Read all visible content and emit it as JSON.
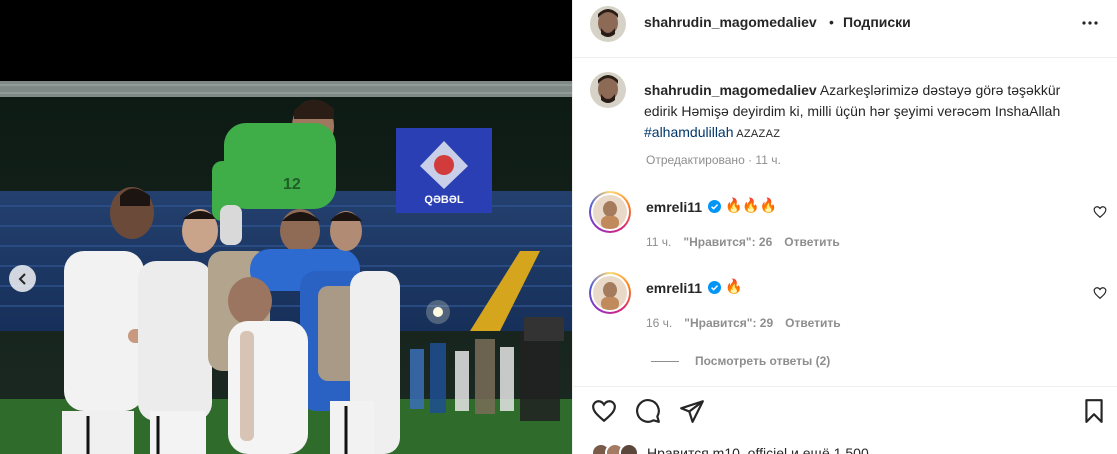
{
  "header": {
    "username": "shahrudin_magomedaliev",
    "separator": "•",
    "follow_label": "Подписки",
    "more_icon": "more-horizontal-icon"
  },
  "caption": {
    "username": "shahrudin_magomedaliev",
    "text_1": " Azarkeşlərimizə dəstəyə görə təşəkkür edirik Həmişə deyirdim ki, milli üçün hər şeyimi verəcəm InshaAllah ",
    "hashtag": "#alhamdulillah",
    "text_2": " AZAZAZ",
    "edited": "Отредактировано",
    "edited_dot": " · ",
    "edited_time": "11 ч."
  },
  "comments": [
    {
      "username": "emreli11",
      "text": "🔥🔥🔥",
      "time": "11 ч.",
      "likes": "\"Нравится\": 26",
      "reply": "Ответить"
    },
    {
      "username": "emreli11",
      "text": "🔥",
      "time": "16 ч.",
      "likes": "\"Нравится\": 29",
      "reply": "Ответить"
    }
  ],
  "view_replies": "Посмотреть ответы (2)",
  "likes_line": "Нравится m10_officiel и ещё 1 500",
  "colors": {
    "link": "#00376b",
    "muted": "#8e8e8e",
    "verified": "#0095f6",
    "pitch": "#2f6b2a",
    "kit_white": "#f2f2f2",
    "gk_green": "#3fae49"
  },
  "photo": {
    "board_label": "QƏBƏL",
    "gk_number": "12"
  }
}
